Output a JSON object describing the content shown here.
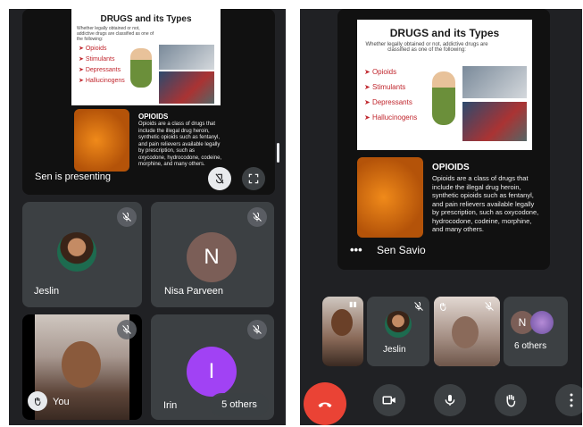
{
  "left": {
    "slide": {
      "title": "DRUGS and its Types",
      "subtitle": "Whether legally obtained or not, addictive drugs are classified as one of the following:",
      "bullets": [
        "Opioids",
        "Stimulants",
        "Depressants",
        "Hallucinogens"
      ],
      "opioids_heading": "OPIOIDS",
      "opioids_text": "Opioids are a class of drugs that include the illegal drug heroin, synthetic opioids such as fentanyl, and pain relievers available legally by prescription, such as oxycodone, hydrocodone, codeine, morphine, and many others."
    },
    "presenting_label": "Sen is presenting",
    "tiles": {
      "jeslin": "Jeslin",
      "nisa": "Nisa Parveen",
      "nisa_initial": "N",
      "you": "You",
      "irin": "Irin",
      "irin_initial": "I",
      "others": "5 others"
    }
  },
  "right": {
    "slide": {
      "title": "DRUGS and its Types",
      "subtitle": "Whether legally obtained or not, addictive drugs are classified as one of the following:",
      "bullets": [
        "Opioids",
        "Stimulants",
        "Depressants",
        "Hallucinogens"
      ],
      "opioids_heading": "OPIOIDS",
      "opioids_text": "Opioids are a class of drugs that include the illegal drug heroin, synthetic opioids such as fentanyl, and pain relievers available legally by prescription, such as oxycodone, hydrocodone, codeine, morphine, and many others."
    },
    "presenter_name": "Sen Savio",
    "strip": {
      "jeslin": "Jeslin",
      "others": "6 others",
      "others_initial": "N"
    }
  },
  "colors": {
    "hangup": "#ea4335",
    "nisa_avatar": "#7b5e57",
    "irin_avatar": "#a142f4",
    "tile": "#3c4043",
    "screen": "#202124"
  }
}
